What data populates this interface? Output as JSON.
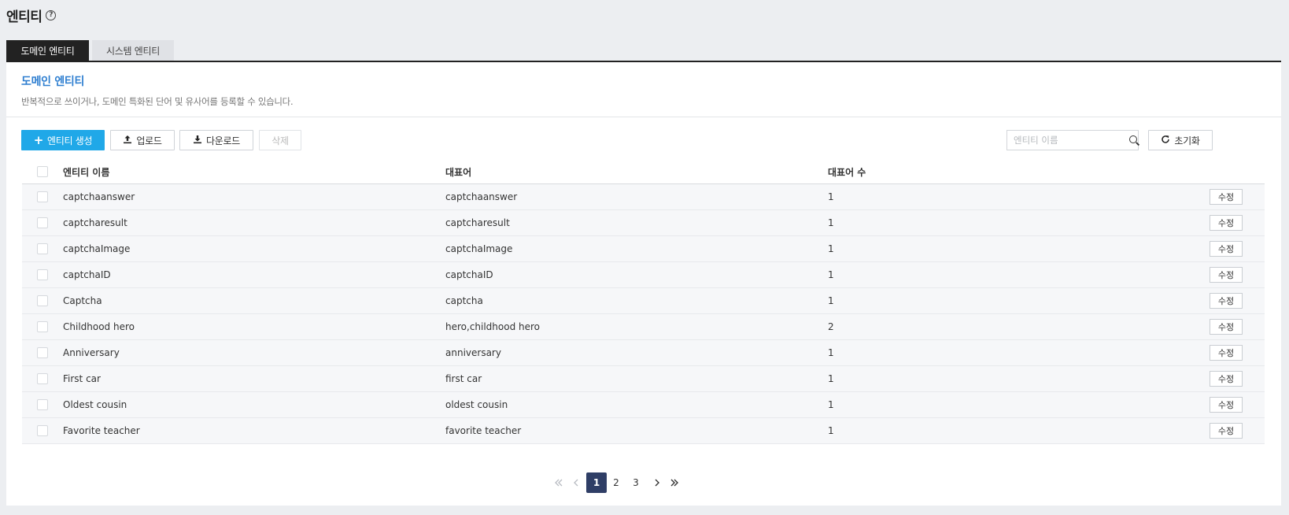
{
  "page": {
    "title": "엔티티",
    "help_icon": "?"
  },
  "tabs": [
    {
      "label": "도메인 엔티티",
      "active": true
    },
    {
      "label": "시스템 엔티티",
      "active": false
    }
  ],
  "section": {
    "title": "도메인 엔티티",
    "description": "반복적으로 쓰이거나, 도메인 특화된 단어 및 유사어를 등록할 수 있습니다."
  },
  "toolbar": {
    "create_label": "엔티티 생성",
    "upload_label": "업로드",
    "download_label": "다운로드",
    "delete_label": "삭제",
    "search_placeholder": "엔티티 이름",
    "reset_label": "초기화"
  },
  "table": {
    "columns": [
      "엔티티 이름",
      "대표어",
      "대표어 수"
    ],
    "edit_label": "수정",
    "rows": [
      {
        "name": "captchaanswer",
        "representative": "captchaanswer",
        "count": "1"
      },
      {
        "name": "captcharesult",
        "representative": "captcharesult",
        "count": "1"
      },
      {
        "name": "captchaImage",
        "representative": "captchaImage",
        "count": "1"
      },
      {
        "name": "captchaID",
        "representative": "captchaID",
        "count": "1"
      },
      {
        "name": "Captcha",
        "representative": "captcha",
        "count": "1"
      },
      {
        "name": "Childhood hero",
        "representative": "hero,childhood hero",
        "count": "2"
      },
      {
        "name": "Anniversary",
        "representative": "anniversary",
        "count": "1"
      },
      {
        "name": "First car",
        "representative": "first car",
        "count": "1"
      },
      {
        "name": "Oldest cousin",
        "representative": "oldest cousin",
        "count": "1"
      },
      {
        "name": "Favorite teacher",
        "representative": "favorite teacher",
        "count": "1"
      }
    ]
  },
  "pagination": {
    "pages": [
      "1",
      "2",
      "3"
    ],
    "current": "1"
  },
  "colors": {
    "primary": "#20a8e8",
    "section_title": "#2d7ed0",
    "tab_active": "#222222",
    "page_active": "#2f3e66"
  }
}
